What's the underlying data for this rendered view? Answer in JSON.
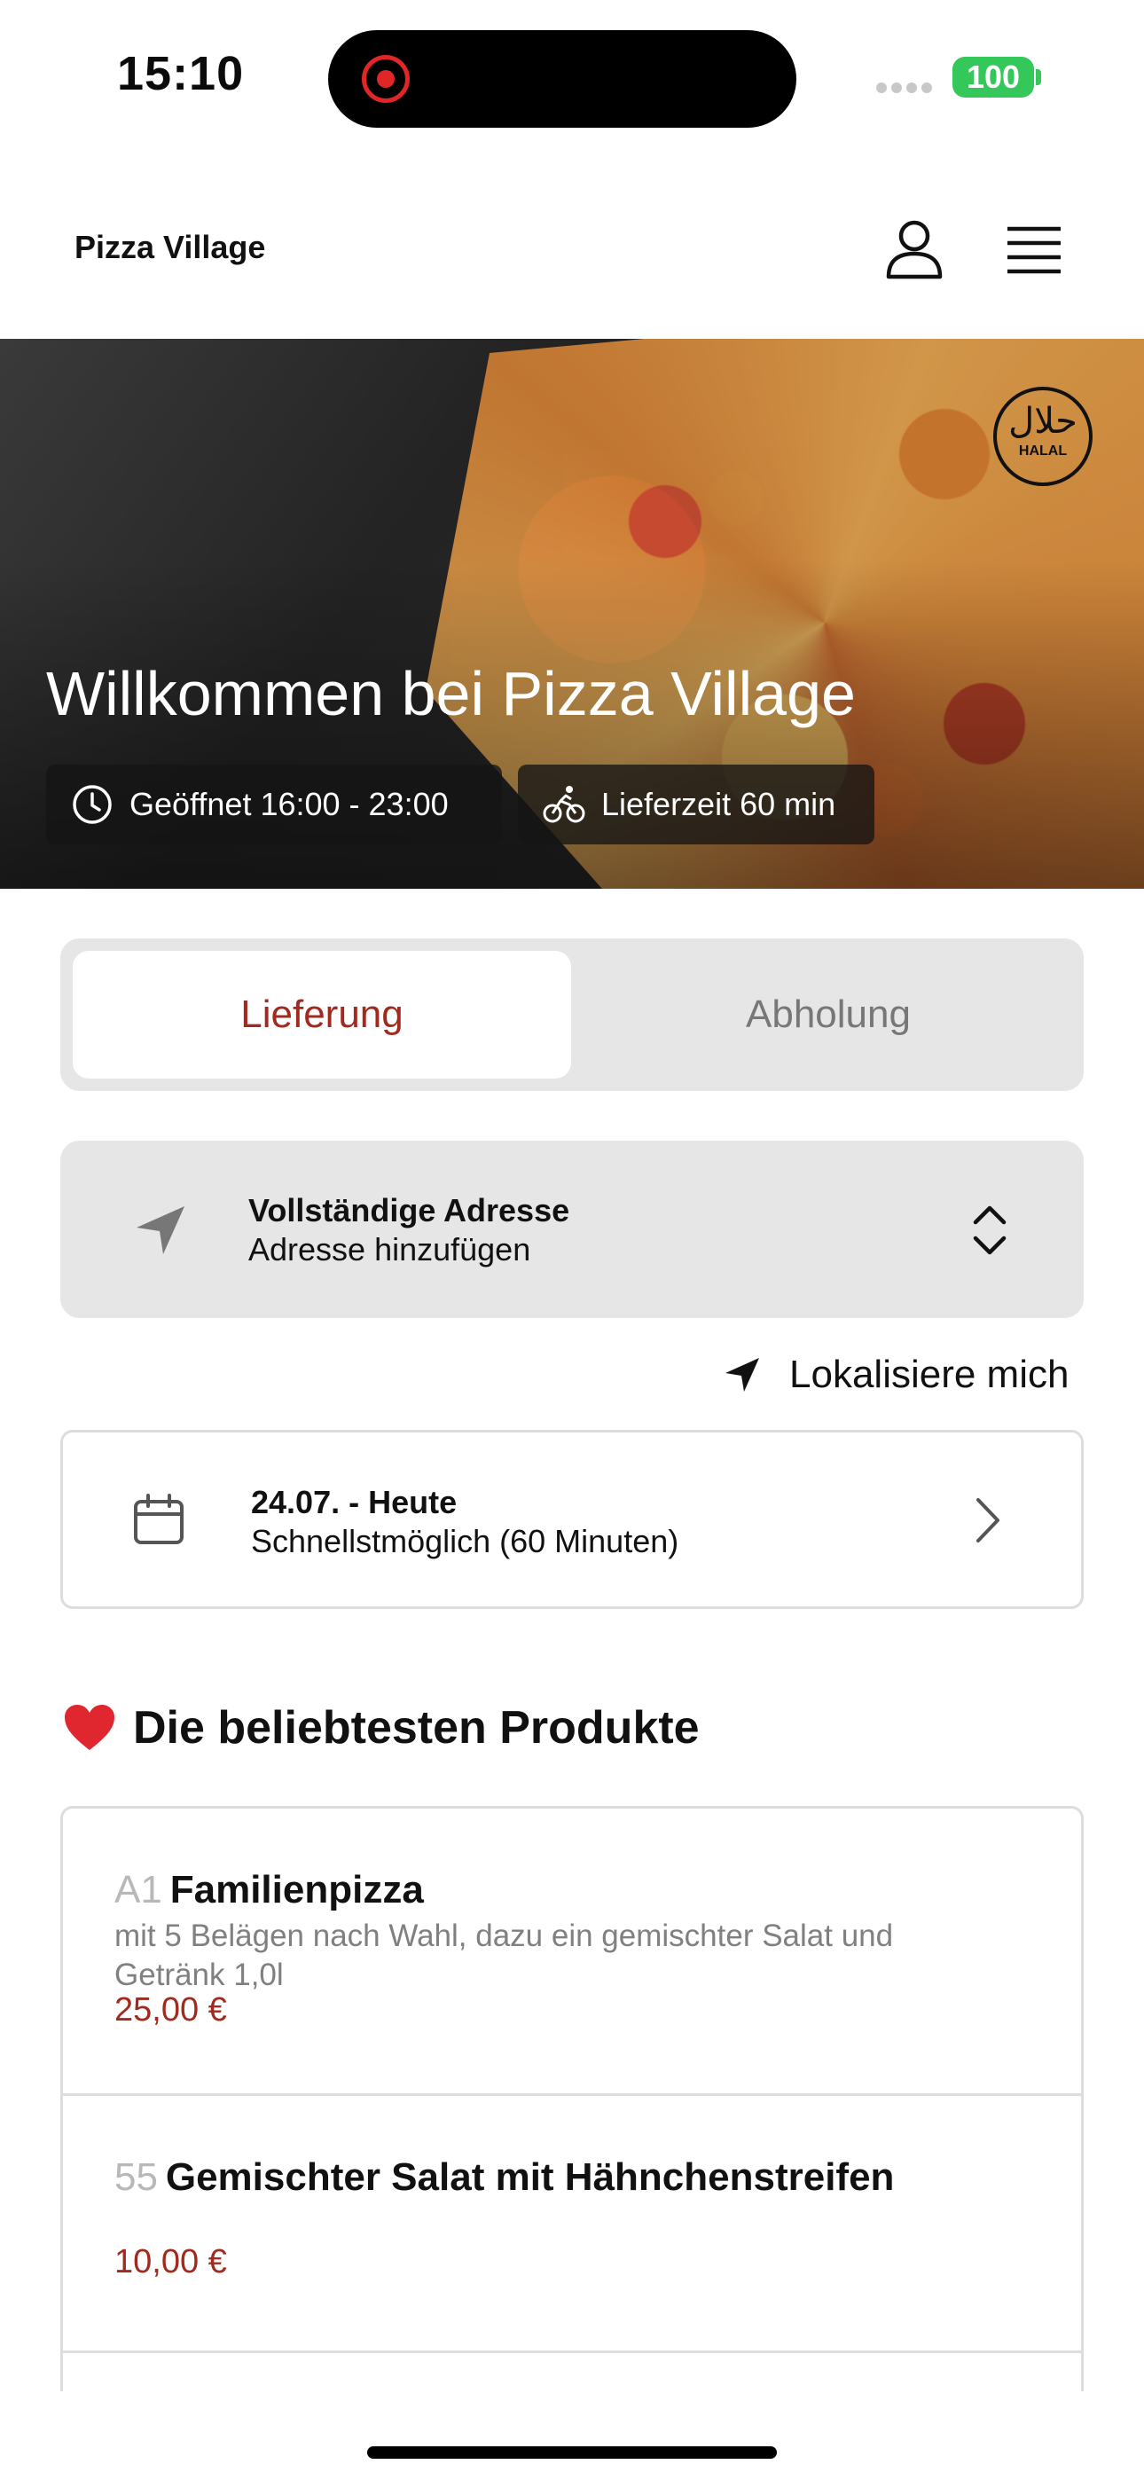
{
  "status_bar": {
    "time": "15:10",
    "battery": "100"
  },
  "header": {
    "brand": "Pizza Village"
  },
  "hero": {
    "badge": {
      "arabic": "حلال",
      "label": "HALAL"
    },
    "title": "Willkommen bei Pizza Village",
    "opening_hours": "Geöffnet 16:00 - 23:00",
    "delivery_time": "Lieferzeit 60 min"
  },
  "mode": {
    "delivery_label": "Lieferung",
    "pickup_label": "Abholung",
    "selected": "Lieferung"
  },
  "address": {
    "title": "Vollständige Adresse",
    "subtitle": "Adresse hinzufügen"
  },
  "locate": {
    "label": "Lokalisiere mich"
  },
  "schedule": {
    "date": "24.07. - Heute",
    "time": "Schnellstmöglich (60 Minuten)"
  },
  "popular": {
    "title": "Die beliebtesten Produkte",
    "items": [
      {
        "number": "A1",
        "name": "Familienpizza",
        "description": "mit 5 Belägen nach Wahl, dazu ein gemischter Salat und Getränk 1,0l",
        "price": "25,00 €"
      },
      {
        "number": "55",
        "name": "Gemischter Salat mit Hähnchenstreifen",
        "price": "10,00 €"
      }
    ]
  },
  "colors": {
    "accent": "#a12a1f",
    "battery": "#34c759",
    "panel": "#e6e6e6"
  }
}
